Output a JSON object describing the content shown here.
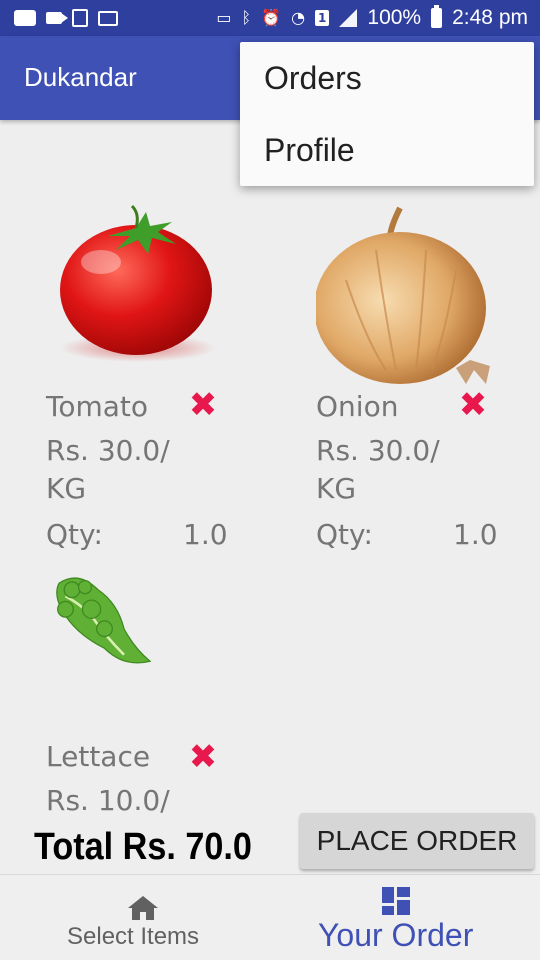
{
  "status_bar": {
    "battery": "100%",
    "time": "2:48 pm",
    "sim_badge": "1"
  },
  "app_bar": {
    "title": "Dukandar"
  },
  "menu": {
    "items": [
      {
        "label": "Orders"
      },
      {
        "label": "Profile"
      }
    ]
  },
  "products": [
    {
      "name": "Tomato",
      "price": "Rs. 30.0/ KG",
      "qty_label": "Qty:",
      "qty_value": "1.0",
      "image": "tomato-image",
      "remove_icon": "✖"
    },
    {
      "name": "Onion",
      "price": "Rs. 30.0/ KG",
      "qty_label": "Qty:",
      "qty_value": "1.0",
      "image": "onion-image",
      "remove_icon": "✖"
    },
    {
      "name": "Lettace",
      "price": "Rs. 10.0/",
      "image": "lettuce-image",
      "remove_icon": "✖"
    }
  ],
  "footer": {
    "total": "Total Rs. 70.0",
    "place_order_label": "PLACE ORDER"
  },
  "bottom_nav": {
    "items": [
      {
        "label": "Select Items",
        "icon": "home-icon"
      },
      {
        "label": "Your Order",
        "icon": "dashboard-icon"
      }
    ]
  },
  "colors": {
    "primary": "#3f51b5",
    "primary_dark": "#2f3f9e",
    "accent_remove": "#e8174c"
  }
}
